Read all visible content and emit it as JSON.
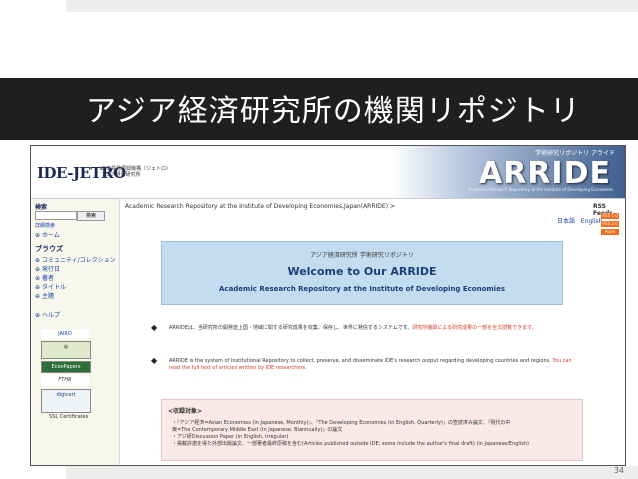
{
  "slide": {
    "title": "アジア経済研究所の機関リポジトリ",
    "page_number": "34"
  },
  "header": {
    "logo": "IDE-JETRO",
    "logo_sub_1": "日本貿易振興機構（ジェトロ）",
    "logo_sub_2": "アジア経済研究所",
    "banner_top": "学術研究リポジトリ アライド",
    "banner_logo": "ARRIDE",
    "banner_sub": "Academic Research Repository at the Institute of Developing Economies"
  },
  "sidebar": {
    "search_heading": "検索",
    "search_button": "検索",
    "search_detail": "詳細検索",
    "home": "ホーム",
    "browse_heading": "ブラウズ",
    "browse_items": [
      "コミュニティ/コレクション",
      "発行日",
      "著者",
      "タイトル",
      "主題"
    ],
    "help": "ヘルプ",
    "badge_jairo": "JAIRO",
    "badge_econpapers": "EconPapers",
    "badge_digicert": "digicert",
    "ssl_label": "SSL Certificates"
  },
  "main": {
    "breadcrumb": "Academic Research Repository at the Institute of Developing Economies,Japan(ARRIDE) >",
    "lang_ja": "日本語",
    "lang_en": "English",
    "rss_title": "RSS Feeds",
    "rss_buttons": [
      "RSS 1.0",
      "RSS 2.0",
      "Atom"
    ],
    "welcome_jp": "アジア経済研究所 学術研究リポジトリ",
    "welcome_title": "Welcome to Our ARRIDE",
    "welcome_sub": "Academic Research Repository at the Institute of Developing Economies",
    "bullet_char": "◆",
    "para1": "ARRIDEは、当研究所の開発途上国・地域に関する研究成果を収集、保存し、世界に発信するシステムです。",
    "para1_red": "研究所機関による研究成果の一部を全文閲覧できます。",
    "para2": "ARRIDE is the system of Institutional Repository to collect, preserve, and disseminate IDE's research output regarding developing countries and regions.",
    "para2_red": "You can read the full text of articles written by IDE researchers.",
    "info_heading": "<収録対象>",
    "info_line1": "・『アジア経済=Asian Economies (in Japanese, Monthly)』、『The Developing Economies (in English, Quarterly)』の查読済み論文、『現代の中",
    "info_line2": "東=The Contemporary Middle East (in Japanese, Biannually)』の論文",
    "info_line3": "・アジ研Discussion Paper (in English, Irregular)",
    "info_line4": "・掲載許諾を得た外部出版論文、一部著者最終原稿を含む(Articles published outside IDE; some include the author's final draft) (in Japanese/English)"
  },
  "colors": {
    "title_bar": "#1f1f1f",
    "welcome_bg": "#c4dcf0",
    "link": "#1a44aa",
    "accent_red": "#d2402e",
    "rss": "#f26c1b"
  }
}
